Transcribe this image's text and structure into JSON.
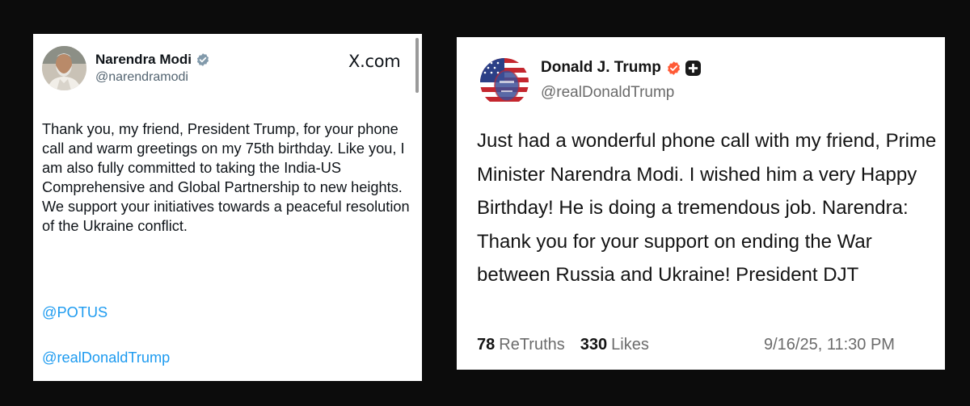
{
  "x_post": {
    "author_name": "Narendra Modi",
    "author_handle": "@narendramodi",
    "brand": "X.com",
    "text": "Thank you, my friend, President Trump, for your phone call and warm greetings on my 75th birthday. Like you, I am also fully committed to taking the India-US Comprehensive and Global Partnership to new heights. We support your initiatives towards a peaceful resolution of the Ukraine conflict.",
    "mentions": [
      "@POTUS",
      "@realDonaldTrump"
    ],
    "verified_icon": "verified-badge-icon",
    "colors": {
      "link": "#1d9bf0",
      "text": "#0f1419",
      "muted": "#536471"
    }
  },
  "truth_post": {
    "author_name": "Donald J. Trump",
    "author_handle": "@realDonaldTrump",
    "text": "Just had a wonderful phone call with my friend, Prime Minister Narendra Modi. I wished him a very Happy Birthday! He is doing a tremendous job. Narendra: Thank you for your support on ending the War between Russia and Ukraine! President DJT",
    "retruths_count": "78",
    "retruths_label": "ReTruths",
    "likes_count": "330",
    "likes_label": "Likes",
    "timestamp": "9/16/25, 11:30 PM",
    "verified_icon": "verified-check-icon",
    "plus_icon": "plus-badge-icon",
    "colors": {
      "badge": "#ff5a36",
      "text": "#141414",
      "muted": "#6b6b6b"
    }
  }
}
